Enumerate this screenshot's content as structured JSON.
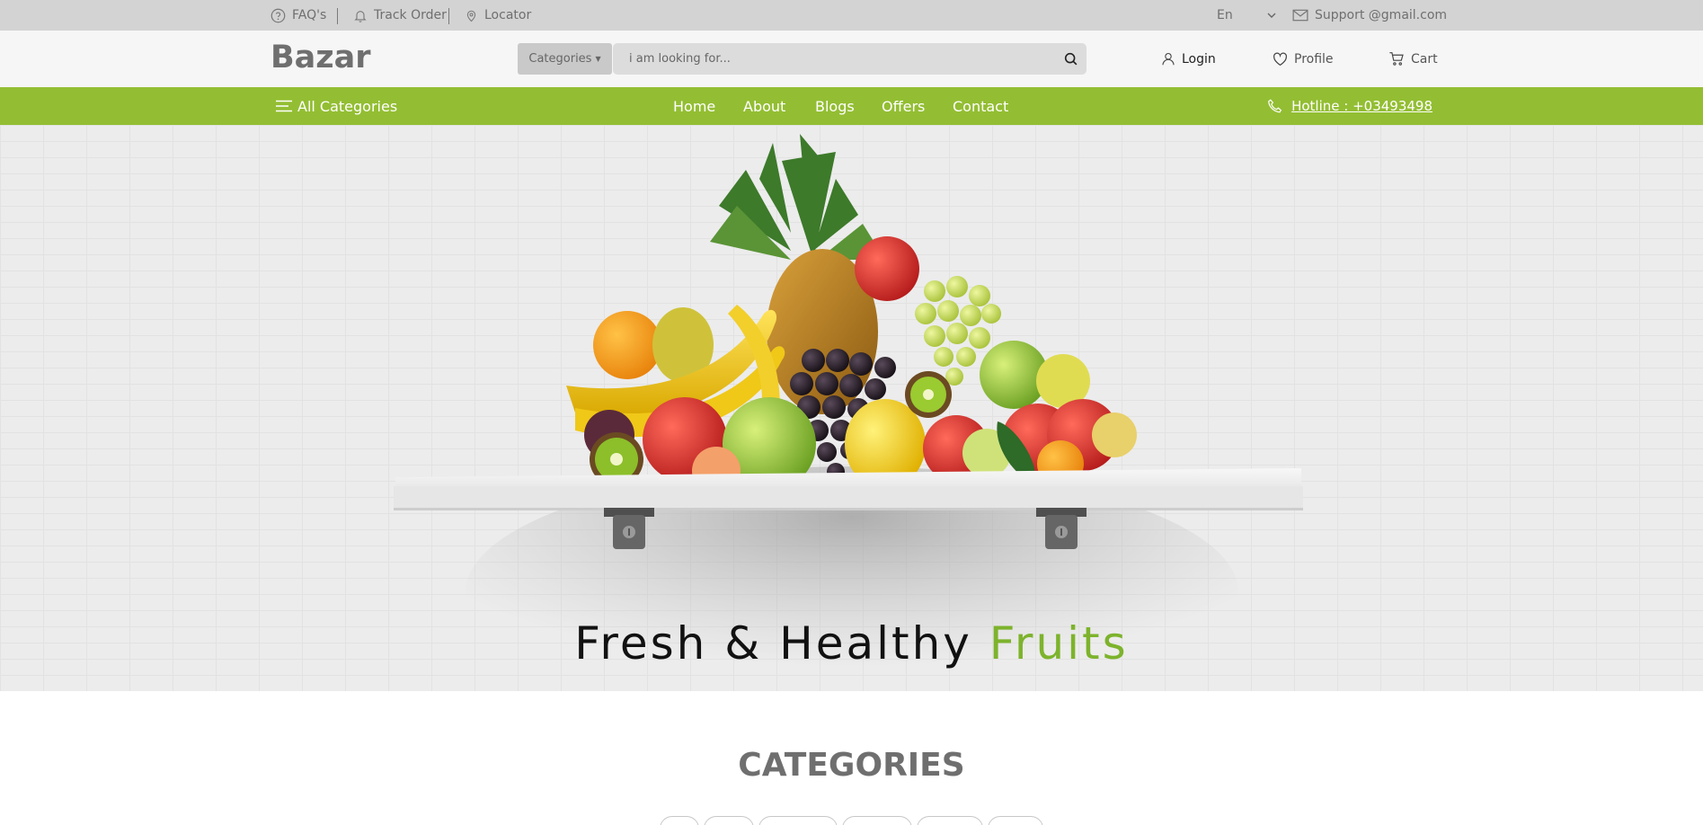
{
  "topbar": {
    "faq_label": "FAQ's",
    "faq_icon": "question-circle-icon",
    "track_label": "Track Order",
    "track_icon": "bell-icon",
    "locator_label": "Locator",
    "locator_icon": "map-pin-icon",
    "language": "En",
    "support_email": "Support @gmail.com",
    "support_icon": "mail-icon"
  },
  "header": {
    "logo": "Bazar",
    "categories_label": "Categories",
    "search_placeholder": "i am looking for...",
    "login_label": "Login",
    "profile_label": "Profile",
    "cart_label": "Cart"
  },
  "nav": {
    "all_categories_label": "All Categories",
    "links": [
      "Home",
      "About",
      "Blogs",
      "Offers",
      "Contact"
    ],
    "hotline": "Hotline : +03493498"
  },
  "hero": {
    "title_main": "Fresh & Healthy ",
    "title_accent": "Fruits"
  },
  "categories": {
    "heading": "CATEGORIES"
  },
  "colors": {
    "brand_green": "#93be33",
    "accent_green": "#7db32c",
    "topbar_gray": "#d3d3d3"
  }
}
